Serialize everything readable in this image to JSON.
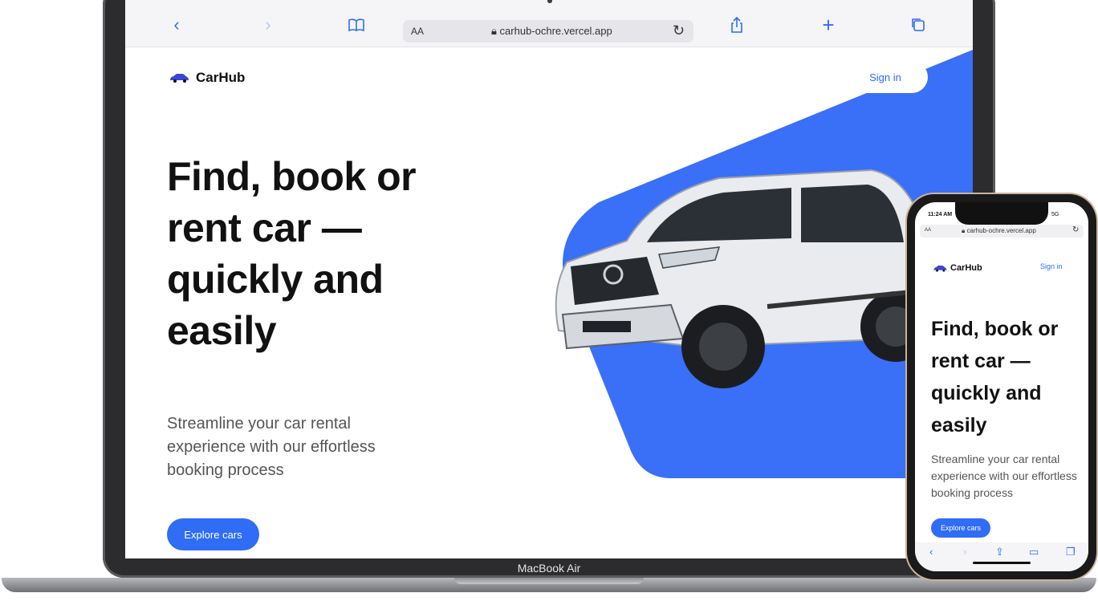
{
  "browser": {
    "url_aa": "AA",
    "url": "carhub-ochre.vercel.app",
    "icons": [
      "back-icon",
      "forward-icon",
      "bookmarks-icon",
      "lock-icon",
      "reload-icon",
      "share-icon",
      "new-tab-icon",
      "tabs-icon"
    ]
  },
  "site": {
    "brand": "CarHub",
    "signin_label": "Sign in",
    "hero_title": "Find, book or rent car — quickly and easily",
    "hero_subtitle": "Streamline your car rental experience with our effortless booking process",
    "explore_label": "Explore cars"
  },
  "device": {
    "laptop_label": "MacBook Air"
  },
  "phone": {
    "time": "11:24 AM",
    "signal": "5G",
    "url_aa": "AA",
    "url": "carhub-ochre.vercel.app",
    "brand": "CarHub",
    "signin_label": "Sign in",
    "hero_title": "Find, book or rent car — quickly and easily",
    "hero_subtitle": "Streamline your car rental experience with our effortless booking process",
    "explore_label": "Explore cars"
  },
  "colors": {
    "accent": "#2f6df6",
    "hero_shape": "#3a6ff7",
    "laptop_body": "#2c2c2e"
  }
}
